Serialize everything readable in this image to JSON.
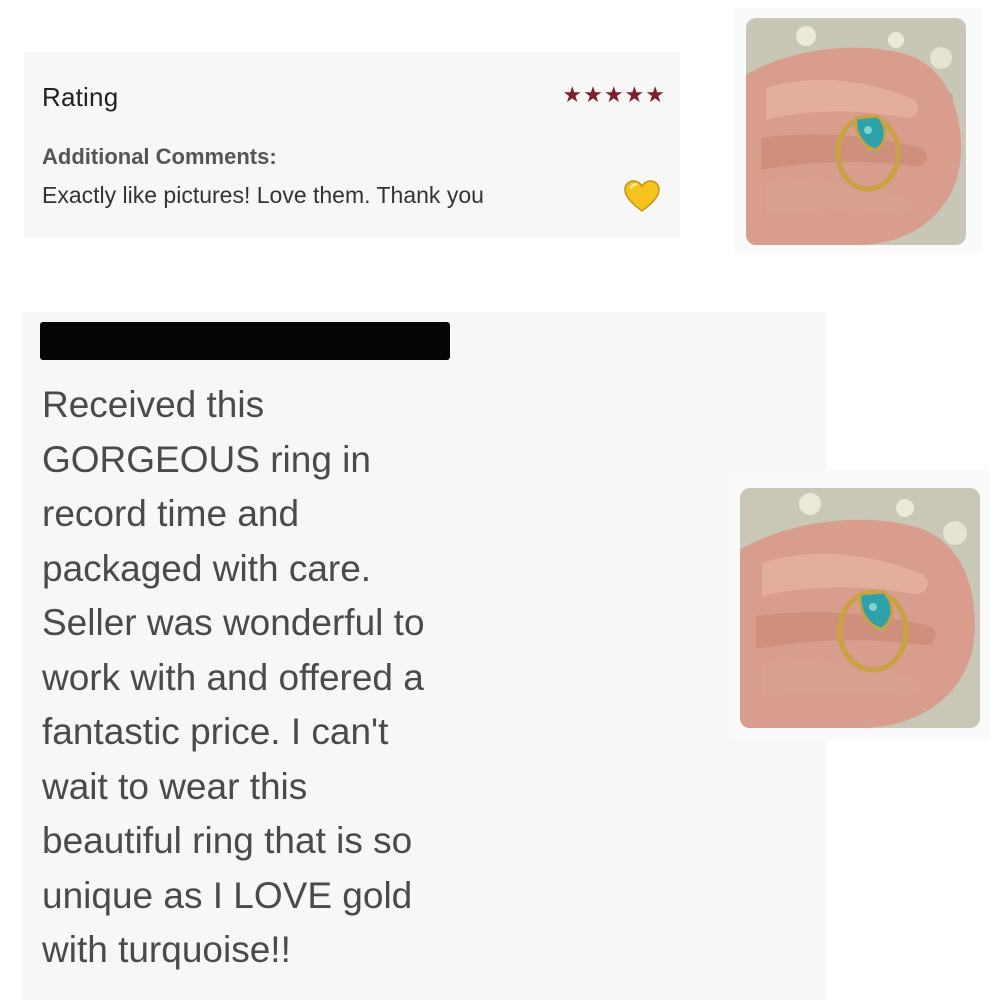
{
  "review1": {
    "rating_label": "Rating",
    "stars": "★★★★★",
    "rating_value": 5,
    "rating_max": 5,
    "star_color": "#7d1f2e",
    "comments_label": "Additional Comments:",
    "comment_text": "Exactly like pictures! Love them. Thank you",
    "emoji": "yellow-heart-icon"
  },
  "review2": {
    "text": "Received this\nGORGEOUS ring in\nrecord time and\npackaged with care.\nSeller was wonderful to\nwork with and offered a\nfantastic price. I can't\nwait to wear this\nbeautiful ring that is so\nunique as I LOVE gold\nwith turquoise!!"
  },
  "colors": {
    "card_background": "#f7f7f7",
    "text_dark": "#222222",
    "text_body": "#4a4a4a"
  }
}
